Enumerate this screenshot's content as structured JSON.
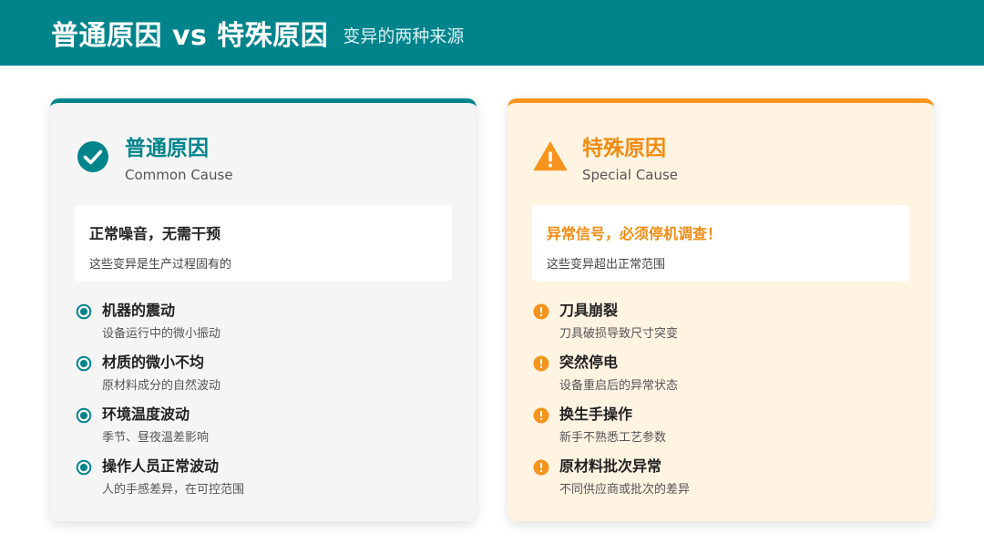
{
  "header": {
    "title": "普通原因 vs 特殊原因",
    "subtitle": "变异的两种来源",
    "color": "#00848c"
  },
  "common": {
    "zh_title": "普通原因",
    "en_title": "Common Cause",
    "icon": "check-circle-icon",
    "accent": "#00848c",
    "note_title": "正常噪音，无需干预",
    "note_desc": "这些变异是生产过程固有的",
    "items": [
      {
        "title": "机器的震动",
        "desc": "设备运行中的微小振动"
      },
      {
        "title": "材质的微小不均",
        "desc": "原材料成分的自然波动"
      },
      {
        "title": "环境温度波动",
        "desc": "季节、昼夜温差影响"
      },
      {
        "title": "操作人员正常波动",
        "desc": "人的手感差异，在可控范围"
      }
    ]
  },
  "special": {
    "zh_title": "特殊原因",
    "en_title": "Special Cause",
    "icon": "warning-triangle-icon",
    "accent": "#f7941d",
    "note_title": "异常信号，必须停机调查！",
    "note_desc": "这些变异超出正常范围",
    "items": [
      {
        "title": "刀具崩裂",
        "desc": "刀具破损导致尺寸突变"
      },
      {
        "title": "突然停电",
        "desc": "设备重启后的异常状态"
      },
      {
        "title": "换生手操作",
        "desc": "新手不熟悉工艺参数"
      },
      {
        "title": "原材料批次异常",
        "desc": "不同供应商或批次的差异"
      }
    ]
  }
}
